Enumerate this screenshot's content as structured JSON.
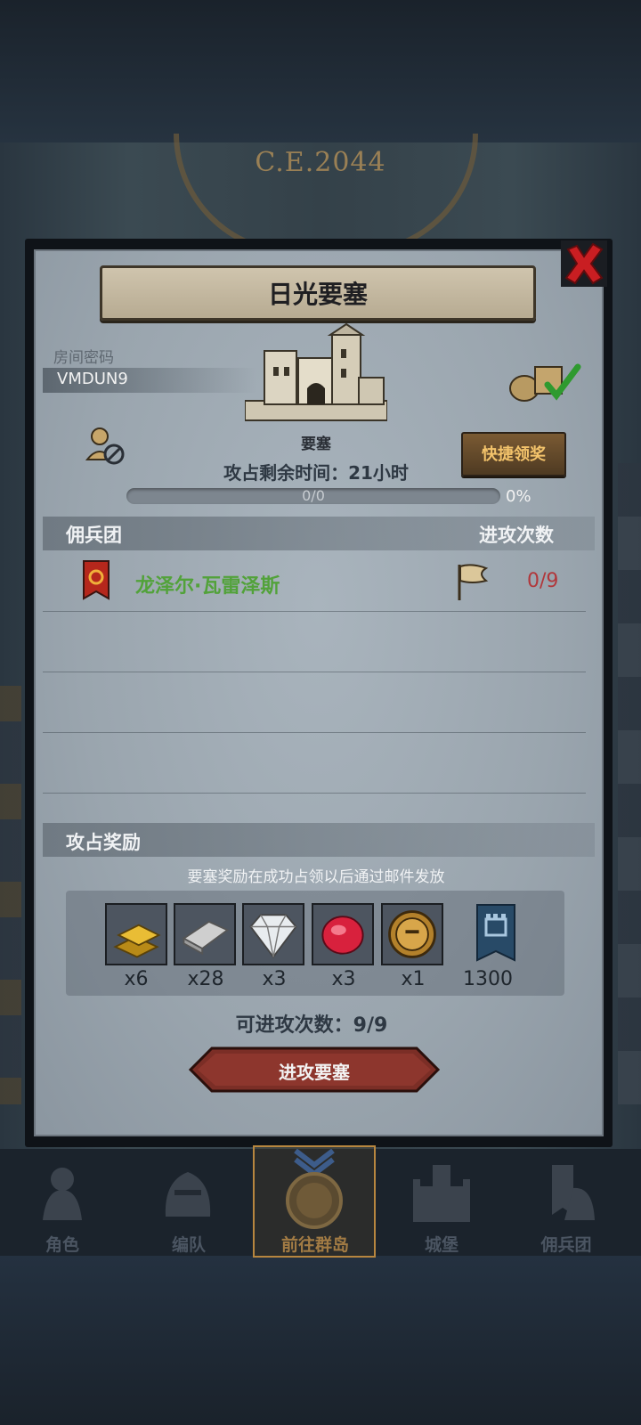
{
  "background": {
    "era": "C.E.2044"
  },
  "dialog": {
    "title": "日光要塞",
    "room": {
      "label": "房间密码",
      "code": "VMDUN9"
    },
    "fortress": {
      "name": "要塞",
      "time_left": "攻占剩余时间：21小时",
      "progress_text": "0/0",
      "percent": "0%",
      "progress_fraction": 0
    },
    "quick_claim": "快捷领奖",
    "mercenary": {
      "header_left": "佣兵团",
      "header_right": "进攻次数",
      "rows": [
        {
          "name": "龙泽尔·瓦雷泽斯",
          "count": "0/9"
        }
      ]
    },
    "rewards": {
      "header": "攻占奖励",
      "note": "要塞奖励在成功占领以后通过邮件发放",
      "items": [
        {
          "icon": "gold-bar-icon",
          "qty": "x6"
        },
        {
          "icon": "silver-bar-icon",
          "qty": "x28"
        },
        {
          "icon": "diamond-icon",
          "qty": "x3"
        },
        {
          "icon": "ruby-icon",
          "qty": "x3"
        },
        {
          "icon": "knight-medal-icon",
          "qty": "x1"
        },
        {
          "icon": "castle-banner-icon",
          "qty": "1300"
        }
      ]
    },
    "attempts": "可进攻次数：9/9",
    "attack_button": "进攻要塞"
  },
  "nav": {
    "items": [
      {
        "label": "角色",
        "icon": "knight-icon"
      },
      {
        "label": "编队",
        "icon": "helmet-icon"
      },
      {
        "label": "前往群岛",
        "icon": "compass-icon"
      },
      {
        "label": "城堡",
        "icon": "castle-icon"
      },
      {
        "label": "佣兵团",
        "icon": "merc-icon"
      }
    ],
    "active_index": 2
  },
  "colors": {
    "merc_name": "#52a23a",
    "attack_count": "#b1373b",
    "accent_gold": "#f3c36b"
  }
}
